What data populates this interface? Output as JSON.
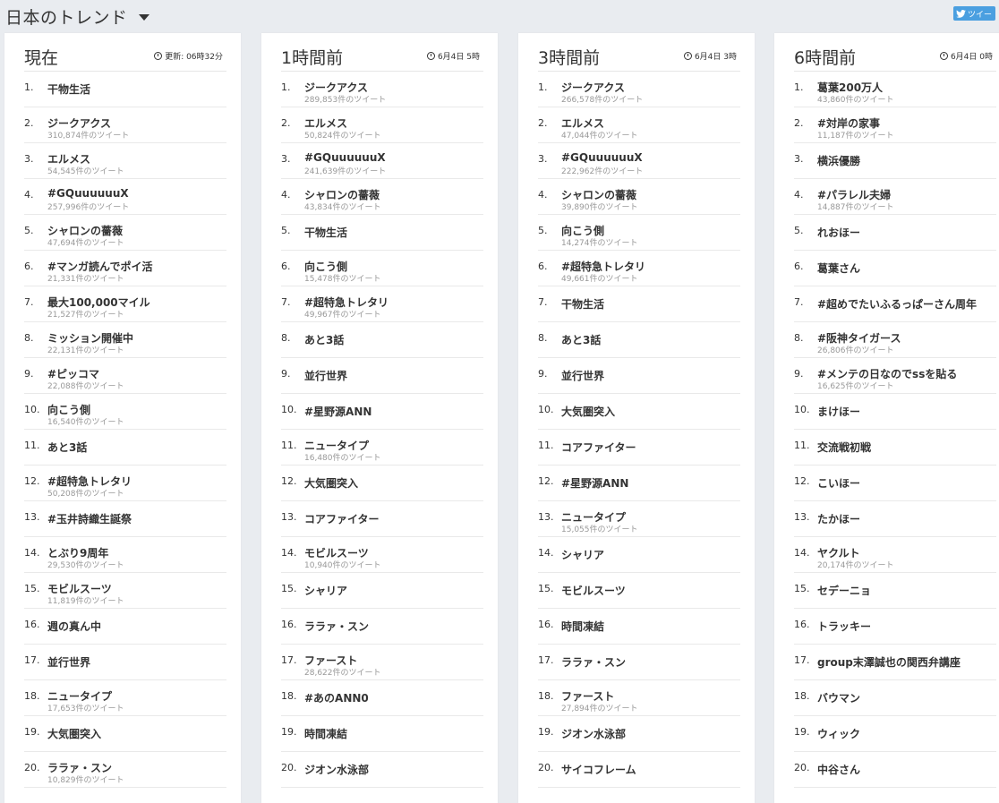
{
  "header": {
    "title": "日本のトレンド",
    "tweet_button": "ツイー"
  },
  "count_suffix": "件のツイート",
  "columns": [
    {
      "title": "現在",
      "time": "更新: 06時32分",
      "trends": [
        {
          "rank": "1.",
          "name": "干物生活",
          "count": ""
        },
        {
          "rank": "2.",
          "name": "ジークアクス",
          "count": "310,874件のツイート"
        },
        {
          "rank": "3.",
          "name": "エルメス",
          "count": "54,545件のツイート"
        },
        {
          "rank": "4.",
          "name": "#GQuuuuuuX",
          "count": "257,996件のツイート"
        },
        {
          "rank": "5.",
          "name": "シャロンの薔薇",
          "count": "47,694件のツイート"
        },
        {
          "rank": "6.",
          "name": "#マンガ読んでポイ活",
          "count": "21,331件のツイート"
        },
        {
          "rank": "7.",
          "name": "最大100,000マイル",
          "count": "21,527件のツイート"
        },
        {
          "rank": "8.",
          "name": "ミッション開催中",
          "count": "22,131件のツイート"
        },
        {
          "rank": "9.",
          "name": "#ピッコマ",
          "count": "22,088件のツイート"
        },
        {
          "rank": "10.",
          "name": "向こう側",
          "count": "16,540件のツイート"
        },
        {
          "rank": "11.",
          "name": "あと3話",
          "count": ""
        },
        {
          "rank": "12.",
          "name": "#超特急トレタリ",
          "count": "50,208件のツイート"
        },
        {
          "rank": "13.",
          "name": "#玉井詩織生誕祭",
          "count": ""
        },
        {
          "rank": "14.",
          "name": "とぶり9周年",
          "count": "29,530件のツイート"
        },
        {
          "rank": "15.",
          "name": "モビルスーツ",
          "count": "11,819件のツイート"
        },
        {
          "rank": "16.",
          "name": "週の真ん中",
          "count": ""
        },
        {
          "rank": "17.",
          "name": "並行世界",
          "count": ""
        },
        {
          "rank": "18.",
          "name": "ニュータイプ",
          "count": "17,653件のツイート"
        },
        {
          "rank": "19.",
          "name": "大気圏突入",
          "count": ""
        },
        {
          "rank": "20.",
          "name": "ララァ・スン",
          "count": "10,829件のツイート"
        }
      ]
    },
    {
      "title": "1時間前",
      "time": "6月4日 5時",
      "trends": [
        {
          "rank": "1.",
          "name": "ジークアクス",
          "count": "289,853件のツイート"
        },
        {
          "rank": "2.",
          "name": "エルメス",
          "count": "50,824件のツイート"
        },
        {
          "rank": "3.",
          "name": "#GQuuuuuuX",
          "count": "241,639件のツイート"
        },
        {
          "rank": "4.",
          "name": "シャロンの薔薇",
          "count": "43,834件のツイート"
        },
        {
          "rank": "5.",
          "name": "干物生活",
          "count": ""
        },
        {
          "rank": "6.",
          "name": "向こう側",
          "count": "15,478件のツイート"
        },
        {
          "rank": "7.",
          "name": "#超特急トレタリ",
          "count": "49,967件のツイート"
        },
        {
          "rank": "8.",
          "name": "あと3話",
          "count": ""
        },
        {
          "rank": "9.",
          "name": "並行世界",
          "count": ""
        },
        {
          "rank": "10.",
          "name": "#星野源ANN",
          "count": ""
        },
        {
          "rank": "11.",
          "name": "ニュータイプ",
          "count": "16,480件のツイート"
        },
        {
          "rank": "12.",
          "name": "大気圏突入",
          "count": ""
        },
        {
          "rank": "13.",
          "name": "コアファイター",
          "count": ""
        },
        {
          "rank": "14.",
          "name": "モビルスーツ",
          "count": "10,940件のツイート"
        },
        {
          "rank": "15.",
          "name": "シャリア",
          "count": ""
        },
        {
          "rank": "16.",
          "name": "ララァ・スン",
          "count": ""
        },
        {
          "rank": "17.",
          "name": "ファースト",
          "count": "28,622件のツイート"
        },
        {
          "rank": "18.",
          "name": "#あのANN0",
          "count": ""
        },
        {
          "rank": "19.",
          "name": "時間凍結",
          "count": ""
        },
        {
          "rank": "20.",
          "name": "ジオン水泳部",
          "count": ""
        }
      ]
    },
    {
      "title": "3時間前",
      "time": "6月4日 3時",
      "trends": [
        {
          "rank": "1.",
          "name": "ジークアクス",
          "count": "266,578件のツイート"
        },
        {
          "rank": "2.",
          "name": "エルメス",
          "count": "47,044件のツイート"
        },
        {
          "rank": "3.",
          "name": "#GQuuuuuuX",
          "count": "222,962件のツイート"
        },
        {
          "rank": "4.",
          "name": "シャロンの薔薇",
          "count": "39,890件のツイート"
        },
        {
          "rank": "5.",
          "name": "向こう側",
          "count": "14,274件のツイート"
        },
        {
          "rank": "6.",
          "name": "#超特急トレタリ",
          "count": "49,661件のツイート"
        },
        {
          "rank": "7.",
          "name": "干物生活",
          "count": ""
        },
        {
          "rank": "8.",
          "name": "あと3話",
          "count": ""
        },
        {
          "rank": "9.",
          "name": "並行世界",
          "count": ""
        },
        {
          "rank": "10.",
          "name": "大気圏突入",
          "count": ""
        },
        {
          "rank": "11.",
          "name": "コアファイター",
          "count": ""
        },
        {
          "rank": "12.",
          "name": "#星野源ANN",
          "count": ""
        },
        {
          "rank": "13.",
          "name": "ニュータイプ",
          "count": "15,055件のツイート"
        },
        {
          "rank": "14.",
          "name": "シャリア",
          "count": ""
        },
        {
          "rank": "15.",
          "name": "モビルスーツ",
          "count": ""
        },
        {
          "rank": "16.",
          "name": "時間凍結",
          "count": ""
        },
        {
          "rank": "17.",
          "name": "ララァ・スン",
          "count": ""
        },
        {
          "rank": "18.",
          "name": "ファースト",
          "count": "27,894件のツイート"
        },
        {
          "rank": "19.",
          "name": "ジオン水泳部",
          "count": ""
        },
        {
          "rank": "20.",
          "name": "サイコフレーム",
          "count": ""
        }
      ]
    },
    {
      "title": "6時間前",
      "time": "6月4日 0時",
      "trends": [
        {
          "rank": "1.",
          "name": "葛葉200万人",
          "count": "43,860件のツイート"
        },
        {
          "rank": "2.",
          "name": "#対岸の家事",
          "count": "11,187件のツイート"
        },
        {
          "rank": "3.",
          "name": "横浜優勝",
          "count": ""
        },
        {
          "rank": "4.",
          "name": "#パラレル夫婦",
          "count": "14,887件のツイート"
        },
        {
          "rank": "5.",
          "name": "れおほー",
          "count": ""
        },
        {
          "rank": "6.",
          "name": "葛葉さん",
          "count": ""
        },
        {
          "rank": "7.",
          "name": "#超めでたいふるっぱーさん周年",
          "count": ""
        },
        {
          "rank": "8.",
          "name": "#阪神タイガース",
          "count": "26,806件のツイート"
        },
        {
          "rank": "9.",
          "name": "#メンテの日なのでssを貼る",
          "count": "16,625件のツイート"
        },
        {
          "rank": "10.",
          "name": "まけほー",
          "count": ""
        },
        {
          "rank": "11.",
          "name": "交流戦初戦",
          "count": ""
        },
        {
          "rank": "12.",
          "name": "こいほー",
          "count": ""
        },
        {
          "rank": "13.",
          "name": "たかほー",
          "count": ""
        },
        {
          "rank": "14.",
          "name": "ヤクルト",
          "count": "20,174件のツイート"
        },
        {
          "rank": "15.",
          "name": "セデーニョ",
          "count": ""
        },
        {
          "rank": "16.",
          "name": "トラッキー",
          "count": ""
        },
        {
          "rank": "17.",
          "name": "group末澤誠也の関西弁講座",
          "count": ""
        },
        {
          "rank": "18.",
          "name": "バウマン",
          "count": ""
        },
        {
          "rank": "19.",
          "name": "ウィック",
          "count": ""
        },
        {
          "rank": "20.",
          "name": "中谷さん",
          "count": ""
        }
      ]
    }
  ]
}
